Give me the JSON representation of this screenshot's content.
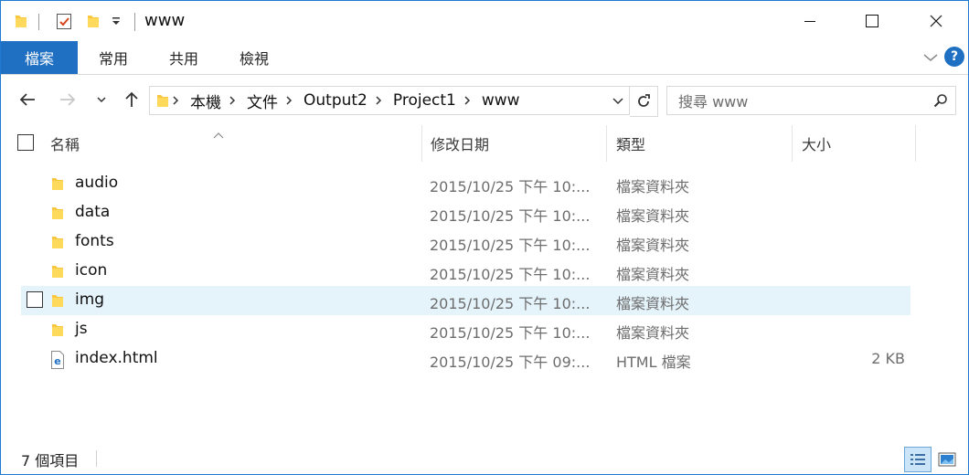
{
  "window": {
    "title": "www"
  },
  "ribbon": {
    "tabs": [
      {
        "label": "檔案"
      },
      {
        "label": "常用"
      },
      {
        "label": "共用"
      },
      {
        "label": "檢視"
      }
    ],
    "help_label": "?"
  },
  "address": {
    "crumbs": [
      "本機",
      "文件",
      "Output2",
      "Project1",
      "www"
    ]
  },
  "search": {
    "placeholder": "搜尋 www"
  },
  "columns": {
    "name": "名稱",
    "date": "修改日期",
    "type": "類型",
    "size": "大小"
  },
  "files": [
    {
      "name": "audio",
      "date": "2015/10/25 下午 10:...",
      "type": "檔案資料夾",
      "size": "",
      "icon": "folder-icon"
    },
    {
      "name": "data",
      "date": "2015/10/25 下午 10:...",
      "type": "檔案資料夾",
      "size": "",
      "icon": "folder-icon"
    },
    {
      "name": "fonts",
      "date": "2015/10/25 下午 10:...",
      "type": "檔案資料夾",
      "size": "",
      "icon": "folder-icon"
    },
    {
      "name": "icon",
      "date": "2015/10/25 下午 10:...",
      "type": "檔案資料夾",
      "size": "",
      "icon": "folder-icon"
    },
    {
      "name": "img",
      "date": "2015/10/25 下午 10:...",
      "type": "檔案資料夾",
      "size": "",
      "icon": "folder-icon",
      "hover": true
    },
    {
      "name": "js",
      "date": "2015/10/25 下午 10:...",
      "type": "檔案資料夾",
      "size": "",
      "icon": "folder-icon"
    },
    {
      "name": "index.html",
      "date": "2015/10/25 下午 09:...",
      "type": "HTML 檔案",
      "size": "2 KB",
      "icon": "edge-html-file-icon"
    }
  ],
  "status": {
    "item_count": "7 個項目"
  },
  "colors": {
    "accent": "#1f6fc2",
    "hover_row": "#e5f3fb",
    "folder": "#f8c63f"
  }
}
